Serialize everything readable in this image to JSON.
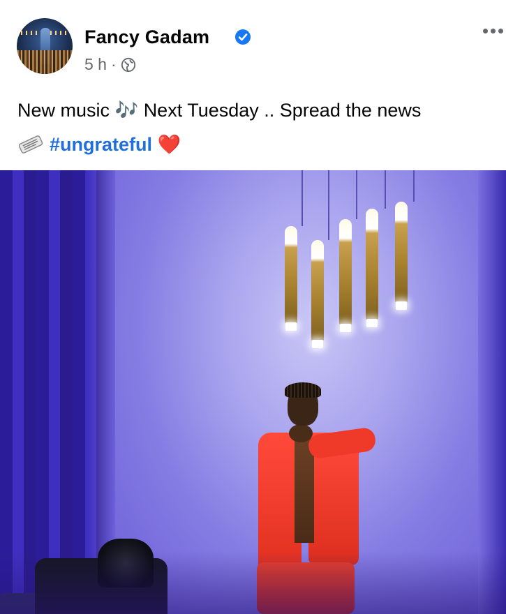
{
  "post": {
    "author_name": "Fancy Gadam",
    "time_ago": "5 h",
    "separator": "·",
    "audience_icon": "globe-icon",
    "verified_icon": "verified-badge-icon",
    "more_icon": "more-options-icon",
    "text_line1_part1": "New music",
    "text_emoji_notes": "🎶",
    "text_line1_part2": "Next Tuesday .. Spread the news",
    "text_emoji_newspaper": "newspaper-icon",
    "hashtag": "#ungrateful",
    "text_emoji_heart": "❤️"
  },
  "colors": {
    "hashtag": "#216fdb",
    "verified": "#1877f2",
    "secondary_text": "#65676b"
  }
}
